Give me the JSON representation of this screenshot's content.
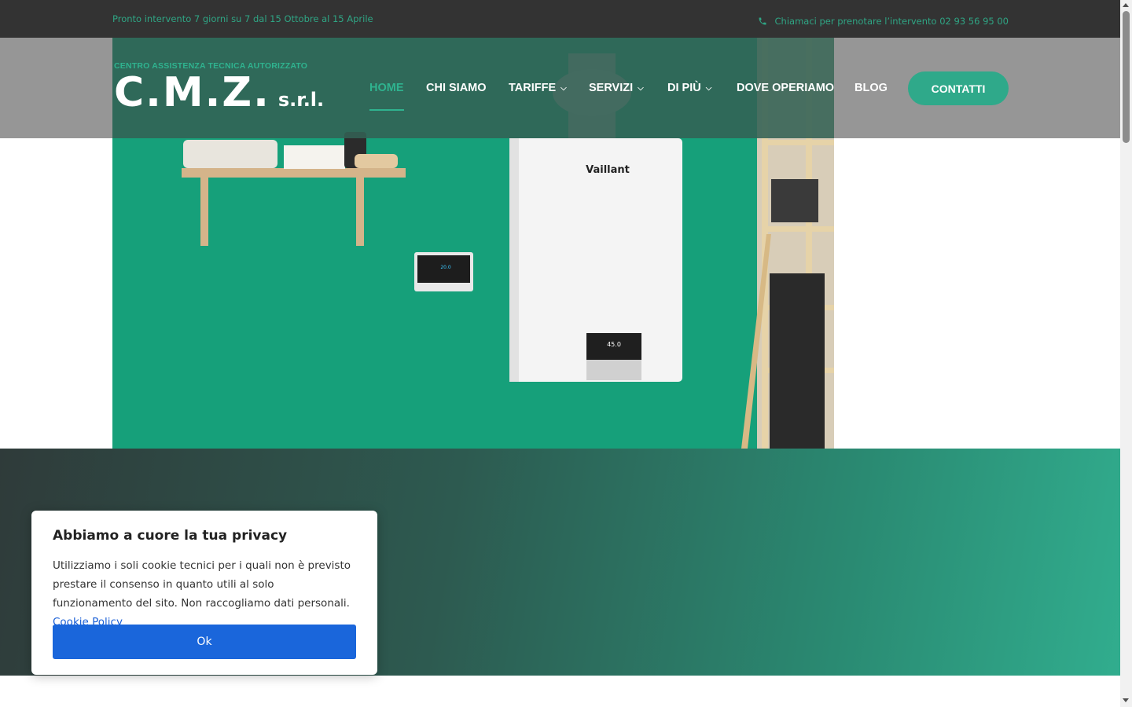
{
  "topbar": {
    "hours": "Pronto intervento 7 giorni su 7 dal 15 Ottobre al 15 Aprile",
    "phone_text": "Chiamaci per prenotare l’intervento 02 93 56 95 00",
    "phone_icon": "phone-icon"
  },
  "logo": {
    "tagline": "CENTRO ASSISTENZA TECNICA AUTORIZZATO",
    "name": "C.M.Z.",
    "suffix": "s.r.l."
  },
  "nav": {
    "items": [
      {
        "label": "HOME",
        "active": true
      },
      {
        "label": "CHI SIAMO"
      },
      {
        "label": "TARIFFE",
        "dropdown": true
      },
      {
        "label": "SERVIZI",
        "dropdown": true
      },
      {
        "label": "DI PIÙ",
        "dropdown": true
      },
      {
        "label": "DOVE OPERIAMO"
      },
      {
        "label": "BLOG"
      }
    ],
    "chevron": "⌄",
    "cta": "CONTATTI"
  },
  "hero": {
    "boiler_brand": "Vaillant",
    "thermostat_display": "20.0",
    "boiler_display": "45.0"
  },
  "cookie": {
    "title": "Abbiamo a cuore la tua privacy",
    "body": "Utilizziamo i soli cookie tecnici per i quali non è previsto prestare il consenso in quanto utili al solo funzionamento del sito. Non raccogliamo dati personali.",
    "link": "Cookie Policy",
    "ok_button": "Ok"
  },
  "colors": {
    "accent": "#2fa98a",
    "topbar": "#333333",
    "ok_button": "#1a66db"
  }
}
